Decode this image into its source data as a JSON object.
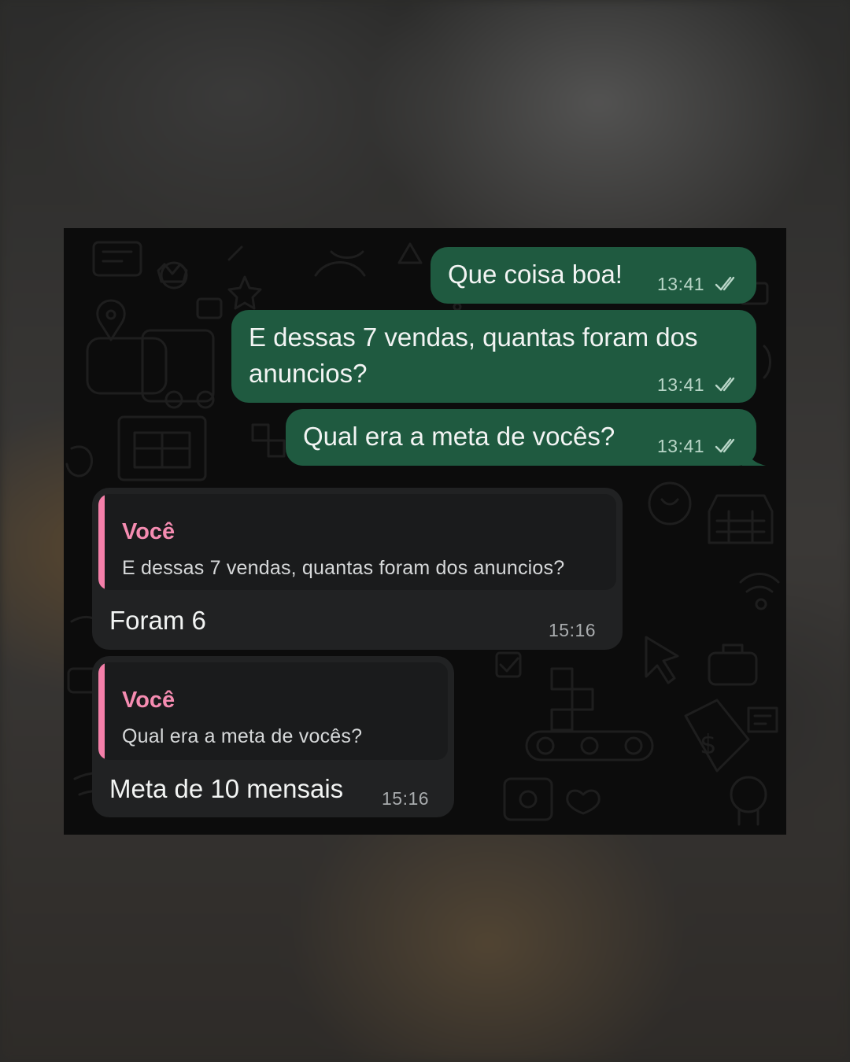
{
  "outgoing": [
    {
      "text": "Que coisa boa!",
      "time": "13:41",
      "status_icon": "double-check-icon"
    },
    {
      "text_line1": "E dessas 7 vendas, quantas foram dos",
      "text_line2": "anuncios?",
      "time": "13:41",
      "status_icon": "double-check-icon"
    },
    {
      "text": "Qual era a meta de vocês?",
      "time": "13:41",
      "status_icon": "double-check-icon"
    }
  ],
  "incoming": [
    {
      "quote_author": "Você",
      "quote_text": "E dessas 7 vendas, quantas foram dos anuncios?",
      "text": "Foram 6",
      "time": "15:16"
    },
    {
      "quote_author": "Você",
      "quote_text": "Qual era a meta de vocês?",
      "text": "Meta de 10 mensais",
      "time": "15:16"
    }
  ],
  "colors": {
    "outgoing_bubble": "#1f5a40",
    "incoming_bubble": "#212223",
    "quote_accent": "#f57fa9",
    "chat_background": "#0c0c0c"
  }
}
